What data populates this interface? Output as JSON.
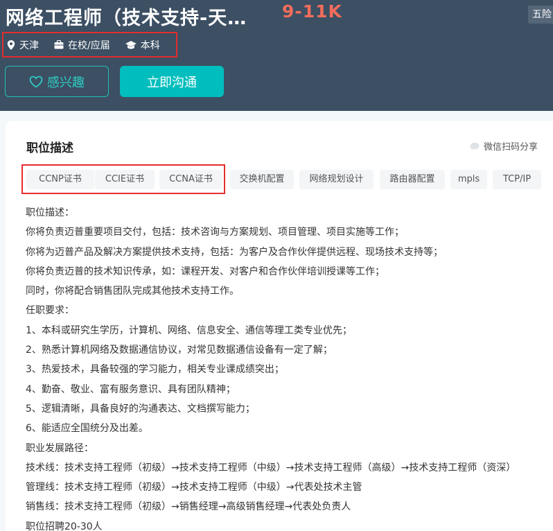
{
  "header": {
    "title": "网络工程师（技术支持-天…",
    "salary": "9-11K",
    "benefit": "五险",
    "meta": {
      "city": "天津",
      "experience": "在校/应届",
      "degree": "本科"
    },
    "interest_label": "感兴趣",
    "chat_label": "立即沟通"
  },
  "card": {
    "section_title": "职位描述",
    "share_label": "微信扫码分享",
    "tags": [
      "CCNP证书",
      "CCIE证书",
      "CCNA证书",
      "交换机配置",
      "网络规划设计",
      "路由器配置",
      "mpls",
      "TCP/IP"
    ],
    "description": [
      "职位描述：",
      "你将负责迈普重要项目交付，包括：技术咨询与方案规划、项目管理、项目实施等工作；",
      "你将为迈普产品及解决方案提供技术支持，包括：为客户及合作伙伴提供远程、现场技术支持等；",
      "你将负责迈普的技术知识传承，如：课程开发、对客户和合作伙伴培训授课等工作；",
      "同时，你将配合销售团队完成其他技术支持工作。",
      "任职要求：",
      "1、本科或研究生学历，计算机、网络、信息安全、通信等理工类专业优先；",
      "2、熟悉计算机网络及数据通信协议，对常见数据通信设备有一定了解；",
      "3、热爱技术，具备较强的学习能力，相关专业课成绩突出；",
      "4、勤奋、敬业、富有服务意识、具有团队精神；",
      "5、逻辑清晰，具备良好的沟通表达、文档撰写能力；",
      "6、能适应全国统分及出差。",
      "职业发展路径：",
      "技术线：技术支持工程师（初级）→技术支持工程师（中级）→技术支持工程师（高级）→技术支持工程师（资深）",
      "管理线：技术支持工程师（初级）→技术支持工程师（中级）→代表处技术主管",
      "销售线：技术支持工程师（初级）→销售经理→高级销售经理→代表处负责人",
      "职位招聘20-30人"
    ]
  },
  "colors": {
    "header_bg": "#3c4f63",
    "accent": "#00bebd",
    "salary": "#f26d5b",
    "highlight_box": "#e52d2d"
  },
  "icons": [
    "location-pin-icon",
    "briefcase-icon",
    "graduation-cap-icon",
    "heart-icon",
    "wechat-icon"
  ]
}
